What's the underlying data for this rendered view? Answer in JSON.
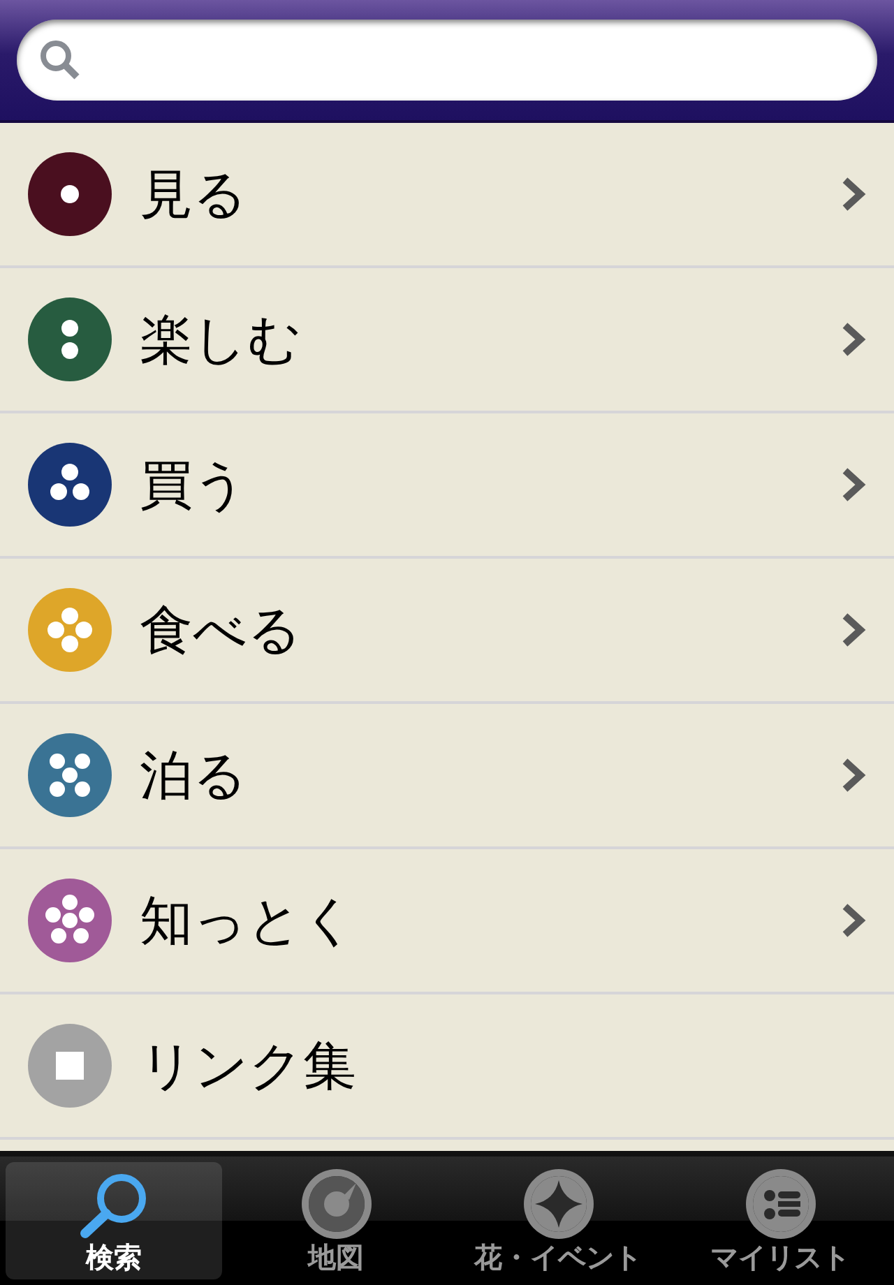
{
  "categories": [
    {
      "label": "見る",
      "color": "#4a0f1f",
      "kind": "category"
    },
    {
      "label": "楽しむ",
      "color": "#275c40",
      "kind": "category"
    },
    {
      "label": "買う",
      "color": "#193675",
      "kind": "category"
    },
    {
      "label": "食べる",
      "color": "#dea629",
      "kind": "category"
    },
    {
      "label": "泊る",
      "color": "#3a7394",
      "kind": "category"
    },
    {
      "label": "知っとく",
      "color": "#a05a98",
      "kind": "category"
    },
    {
      "label": "リンク集",
      "color": "#a3a3a3",
      "kind": "link"
    }
  ],
  "tabs": [
    {
      "label": "検索",
      "selected": true
    },
    {
      "label": "地図",
      "selected": false
    },
    {
      "label": "花・イベント",
      "selected": false
    },
    {
      "label": "マイリスト",
      "selected": false
    }
  ]
}
